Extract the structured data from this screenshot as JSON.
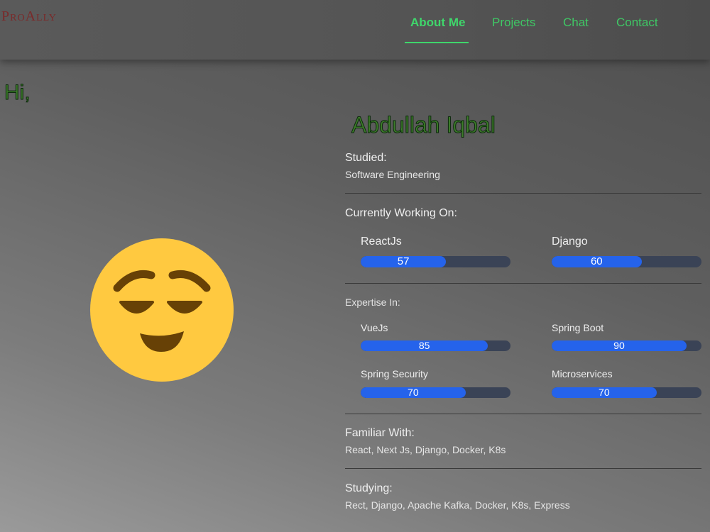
{
  "nav": {
    "brand": "ProAlly",
    "items": [
      {
        "label": "About Me",
        "active": true
      },
      {
        "label": "Projects",
        "active": false
      },
      {
        "label": "Chat",
        "active": false
      },
      {
        "label": "Contact",
        "active": false
      }
    ]
  },
  "colors": {
    "accent": "#3fd66b",
    "progress_fill": "#2563eb",
    "progress_track": "#3a4356",
    "emoji_face": "#ffc940",
    "emoji_features": "#674106"
  },
  "hero": {
    "greeting": "Hi,",
    "avatar_icon": "relieved-face-emoji-icon"
  },
  "profile": {
    "name": "Abdullah Iqbal",
    "studied": {
      "label": "Studied:",
      "value": "Software Engineering"
    },
    "working_on": {
      "label": "Currently Working On:",
      "skills": [
        {
          "name": "ReactJs",
          "value": "57",
          "percent": 57
        },
        {
          "name": "Django",
          "value": "60",
          "percent": 60
        }
      ]
    },
    "expertise": {
      "label": "Expertise In:",
      "skills": [
        {
          "name": "VueJs",
          "value": "85",
          "percent": 85
        },
        {
          "name": "Spring Boot",
          "value": "90",
          "percent": 90
        },
        {
          "name": "Spring Security",
          "value": "70",
          "percent": 70
        },
        {
          "name": "Microservices",
          "value": "70",
          "percent": 70
        }
      ]
    },
    "familiar": {
      "label": "Familiar With:",
      "value": "React, Next Js, Django, Docker, K8s"
    },
    "studying": {
      "label": "Studying:",
      "value": "Rect, Django, Apache Kafka, Docker, K8s, Express"
    }
  }
}
